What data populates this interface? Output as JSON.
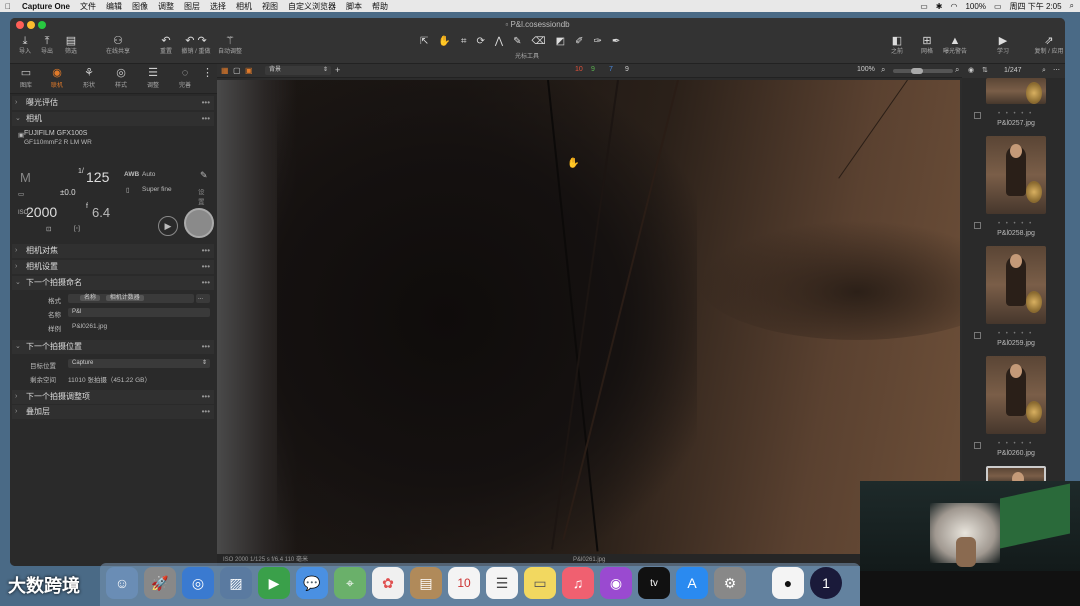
{
  "menubar": {
    "app_name": "Capture One",
    "items": [
      "文件",
      "编辑",
      "图像",
      "调整",
      "图层",
      "选择",
      "相机",
      "视图",
      "自定义浏览器",
      "脚本",
      "帮助"
    ],
    "battery": "100%",
    "clock": "周四 下午 2:05"
  },
  "window": {
    "title": "P&l.cosessiondb"
  },
  "toolbar": {
    "import_label": "导入",
    "export_label": "导出",
    "filter_label": "筛选",
    "share_label": "在线共享",
    "reset_label": "重置",
    "undo_redo_label": "撤销 / 重做",
    "auto_adjust_label": "自动调整",
    "cursor_tools_label": "光标工具",
    "before_label": "之前",
    "grid_label": "网格",
    "exposure_warn_label": "曝光警告",
    "learn_label": "学习",
    "copy_apply_label": "复制 / 应用"
  },
  "left_tabs": [
    {
      "label": "图库",
      "icon": "library-icon"
    },
    {
      "label": "联机",
      "icon": "tether-icon"
    },
    {
      "label": "形状",
      "icon": "shape-icon"
    },
    {
      "label": "样式",
      "icon": "style-icon"
    },
    {
      "label": "调整",
      "icon": "adjust-icon"
    },
    {
      "label": "完善",
      "icon": "refine-icon"
    }
  ],
  "sections": {
    "exposure_eval": "曝光评估",
    "camera": "相机",
    "camera_focus": "相机对焦",
    "camera_settings": "相机设置",
    "next_capture_naming": "下一个拍摄命名",
    "next_capture_location": "下一个拍摄位置",
    "next_capture_adjustments": "下一个拍摄调整项",
    "overlay": "叠加层"
  },
  "camera": {
    "model": "FUJIFILM GFX100S",
    "lens": "GF110mmF2 R LM WR",
    "mode": "M",
    "shutter_prefix": "1/",
    "shutter": "125",
    "ev": "±0.0",
    "iso_label": "ISO",
    "iso": "2000",
    "aperture_prefix": "f",
    "aperture": "6.4",
    "wb_label": "AWB",
    "wb_value": "Auto",
    "quality": "Super fine",
    "settings_label": "设置"
  },
  "naming": {
    "format_label": "格式",
    "format_tokens": [
      "名称",
      "相机计数器"
    ],
    "name_label": "名称",
    "name_value": "P&l",
    "sample_label": "样例",
    "sample_value": "P&l0261.jpg"
  },
  "location": {
    "dest_label": "目标位置",
    "dest_value": "Capture",
    "space_label": "剩余空间",
    "space_value": "11010 张拍摄（451.22 GB）"
  },
  "viewer": {
    "style_select": "背景",
    "counts": [
      "10",
      "9",
      "7",
      "9"
    ],
    "zoom": "100%",
    "status_left": "ISO 2000    1/125 s    f/6.4    110 毫米",
    "status_file": "P&l0261.jpg"
  },
  "browser": {
    "counter": "1/247",
    "thumbnails": [
      "P&l0257.jpg",
      "P&l0258.jpg",
      "P&l0259.jpg",
      "P&l0260.jpg"
    ],
    "stars": "• • • • •"
  },
  "watermark": "大数跨境",
  "colors": {
    "accent": "#e07a2a",
    "panel": "#2a2a2a",
    "count_red": "#e0503a",
    "count_green": "#5ab050",
    "count_blue": "#4a8ae0"
  }
}
